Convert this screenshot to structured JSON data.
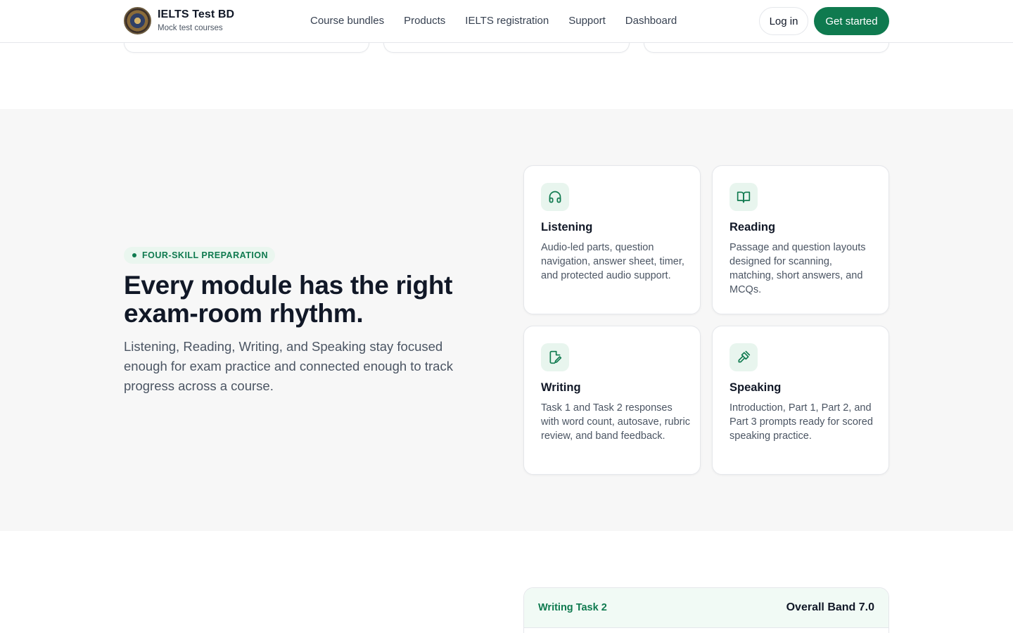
{
  "brand": {
    "name": "IELTS Test BD",
    "tagline": "Mock test courses"
  },
  "nav": [
    "Course bundles",
    "Products",
    "IELTS registration",
    "Support",
    "Dashboard"
  ],
  "actions": {
    "login": "Log in",
    "get_started": "Get started"
  },
  "colors": {
    "accent": "#0f7a4f",
    "accent_soft": "#e8f5ee",
    "section_bg": "#f7f7f7"
  },
  "section": {
    "eyebrow": "FOUR-SKILL PREPARATION",
    "headline": "Every module has the right exam-room rhythm.",
    "description": "Listening, Reading, Writing, and Speaking stay focused enough for exam practice and connected enough to track progress across a course.",
    "modules": [
      {
        "title": "Listening",
        "icon": "headphones-icon",
        "description": "Audio-led parts, question navigation, answer sheet, timer, and protected audio support."
      },
      {
        "title": "Reading",
        "icon": "book-open-icon",
        "description": "Passage and question layouts designed for scanning, matching, short answers, and MCQs."
      },
      {
        "title": "Writing",
        "icon": "file-edit-icon",
        "description": "Task 1 and Task 2 responses with word count, autosave, rubric review, and band feedback."
      },
      {
        "title": "Speaking",
        "icon": "microphone-icon",
        "description": "Introduction, Part 1, Part 2, and Part 3 prompts ready for scored speaking practice."
      }
    ]
  },
  "result_panel": {
    "label": "Writing Task 2",
    "band": "Overall Band 7.0"
  }
}
